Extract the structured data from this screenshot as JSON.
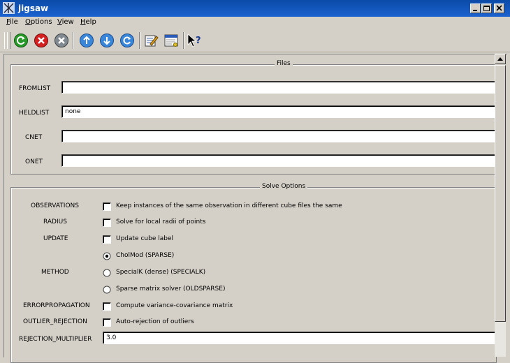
{
  "window": {
    "title": "jigsaw"
  },
  "menu": [
    {
      "label": "File",
      "mnemonic": "F",
      "rest": "ile"
    },
    {
      "label": "Options",
      "mnemonic": "O",
      "rest": "ptions"
    },
    {
      "label": "View",
      "mnemonic": "V",
      "rest": "iew"
    },
    {
      "label": "Help",
      "mnemonic": "H",
      "rest": "elp"
    }
  ],
  "toolbar": {
    "icons": [
      "run-icon",
      "stop-icon",
      "cancel-icon",
      "upload-icon",
      "download-icon",
      "refresh-icon",
      "edit-parameters-icon",
      "window-icon",
      "whats-this-icon"
    ]
  },
  "files": {
    "group_title": "Files",
    "fields": [
      {
        "label": "FROMLIST",
        "value": ""
      },
      {
        "label": "HELDLIST",
        "value": "none"
      },
      {
        "label": "CNET",
        "value": ""
      },
      {
        "label": "ONET",
        "value": ""
      }
    ]
  },
  "solve": {
    "group_title": "Solve Options",
    "observations": {
      "label": "OBSERVATIONS",
      "option": "Keep instances of the same observation in different cube files the same",
      "checked": false
    },
    "radius": {
      "label": "RADIUS",
      "option": "Solve for local radii of points",
      "checked": false
    },
    "update": {
      "label": "UPDATE",
      "option": "Update cube label",
      "checked": false
    },
    "method": {
      "label": "METHOD",
      "options": [
        {
          "text": "CholMod (SPARSE)",
          "selected": true
        },
        {
          "text": "SpecialK (dense) (SPECIALK)",
          "selected": false
        },
        {
          "text": "Sparse matrix solver (OLDSPARSE)",
          "selected": false
        }
      ]
    },
    "errorpropagation": {
      "label": "ERRORPROPAGATION",
      "option": "Compute variance-covariance matrix",
      "checked": false
    },
    "outlier_rejection": {
      "label": "OUTLIER_REJECTION",
      "option": "Auto-rejection of outliers",
      "checked": false
    },
    "rejection_multiplier": {
      "label": "REJECTION_MULTIPLIER",
      "value": "3.0"
    }
  }
}
